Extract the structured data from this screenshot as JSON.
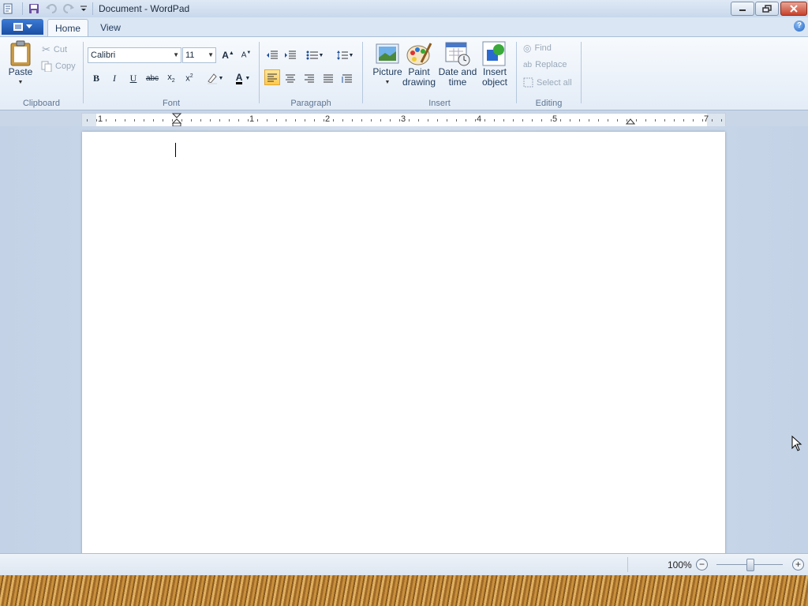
{
  "window": {
    "title": "Document - WordPad"
  },
  "quick_access": {
    "save_icon": "save-icon",
    "undo_icon": "undo-icon",
    "redo_icon": "redo-icon",
    "customize_icon": "chevron-down-icon"
  },
  "tabs": [
    {
      "label": "Home",
      "active": true
    },
    {
      "label": "View",
      "active": false
    }
  ],
  "help_label": "?",
  "clipboard": {
    "paste": "Paste",
    "cut": "Cut",
    "copy": "Copy",
    "group": "Clipboard"
  },
  "font": {
    "family": "Calibri",
    "size": "11",
    "group": "Font"
  },
  "paragraph": {
    "group": "Paragraph"
  },
  "insert": {
    "picture": "Picture",
    "paint_1": "Paint",
    "paint_2": "drawing",
    "datetime_1": "Date and",
    "datetime_2": "time",
    "object_1": "Insert",
    "object_2": "object",
    "group": "Insert"
  },
  "editing": {
    "find": "Find",
    "replace": "Replace",
    "select_all": "Select all",
    "group": "Editing"
  },
  "ruler": {
    "labels": [
      "1",
      "1",
      "2",
      "3",
      "4",
      "5",
      "7"
    ]
  },
  "status": {
    "zoom": "100%",
    "zoom_out": "−",
    "zoom_in": "+"
  },
  "colors": {
    "accent": "#1b4fa4",
    "ribbon": "#e3ecf7",
    "active_button": "#ffc94b"
  }
}
